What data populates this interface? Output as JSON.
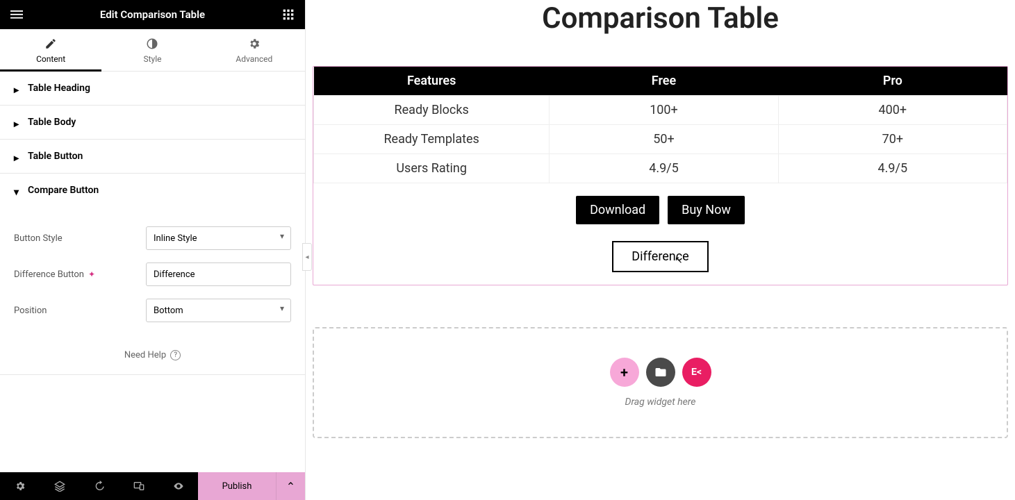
{
  "header": {
    "title": "Edit Comparison Table"
  },
  "tabs": {
    "content": "Content",
    "style": "Style",
    "advanced": "Advanced"
  },
  "sections": {
    "heading": "Table Heading",
    "body": "Table Body",
    "button": "Table Button",
    "compare": "Compare Button"
  },
  "fields": {
    "button_style_label": "Button Style",
    "button_style_value": "Inline Style",
    "diff_label": "Difference Button",
    "diff_value": "Difference",
    "position_label": "Position",
    "position_value": "Bottom"
  },
  "help": "Need Help",
  "footer": {
    "publish": "Publish"
  },
  "canvas": {
    "title": "Comparison Table",
    "cols": {
      "c0": "Features",
      "c1": "Free",
      "c2": "Pro"
    },
    "rows": [
      {
        "c0": "Ready Blocks",
        "c1": "100+",
        "c2": "400+"
      },
      {
        "c0": "Ready Templates",
        "c1": "50+",
        "c2": "70+"
      },
      {
        "c0": "Users Rating",
        "c1": "4.9/5",
        "c2": "4.9/5"
      }
    ],
    "btn_download": "Download",
    "btn_buy": "Buy Now",
    "btn_diff": "Difference",
    "drop_text": "Drag widget here"
  }
}
